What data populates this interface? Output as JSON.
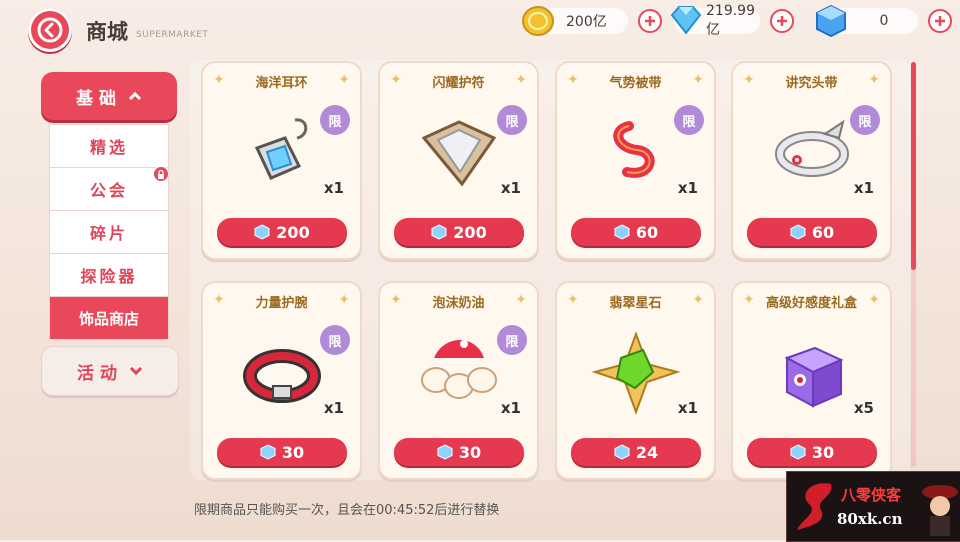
{
  "header": {
    "title": "商城",
    "subtitle": "SUPERMARKET"
  },
  "currencies": [
    {
      "name": "coin-icon",
      "value": "200亿"
    },
    {
      "name": "diamond-icon",
      "value": "219.99亿"
    },
    {
      "name": "crystal-cube-icon",
      "value": "0"
    }
  ],
  "sidebar": {
    "top": {
      "label": "基础",
      "icon": "chevron-up-icon"
    },
    "items": [
      {
        "label": "精选"
      },
      {
        "label": "公会",
        "locked": true
      },
      {
        "label": "碎片"
      },
      {
        "label": "探险器"
      },
      {
        "label": "饰品商店",
        "active": true
      }
    ],
    "bottom": {
      "label": "活动",
      "icon": "chevron-down-icon"
    }
  },
  "items": [
    {
      "name": "海洋耳环",
      "qty": "x1",
      "price": "200",
      "limited": "限",
      "icon": "ocean-earring-icon"
    },
    {
      "name": "闪耀护符",
      "qty": "x1",
      "price": "200",
      "limited": "限",
      "icon": "shining-amulet-icon"
    },
    {
      "name": "气势被带",
      "qty": "x1",
      "price": "60",
      "limited": "限",
      "icon": "ribbon-icon"
    },
    {
      "name": "讲究头带",
      "qty": "x1",
      "price": "60",
      "limited": "限",
      "icon": "headband-icon"
    },
    {
      "name": "力量护腕",
      "qty": "x1",
      "price": "30",
      "limited": "限",
      "icon": "wristband-icon"
    },
    {
      "name": "泡沫奶油",
      "qty": "x1",
      "price": "30",
      "limited": "限",
      "icon": "whipped-cream-icon"
    },
    {
      "name": "翡翠星石",
      "qty": "x1",
      "price": "24",
      "limited": "",
      "icon": "emerald-star-icon"
    },
    {
      "name": "高级好感度礼盒",
      "qty": "x5",
      "price": "30",
      "limited": "",
      "icon": "gift-box-icon"
    }
  ],
  "notice": "限期商品只能购买一次，且会在00:45:52后进行替换",
  "watermark": {
    "line1": "八零侠客",
    "line2": "80xk.cn"
  },
  "colors": {
    "accent": "#e8485a",
    "card_title": "#9c6a1f",
    "limit_badge": "#b18ad8"
  }
}
